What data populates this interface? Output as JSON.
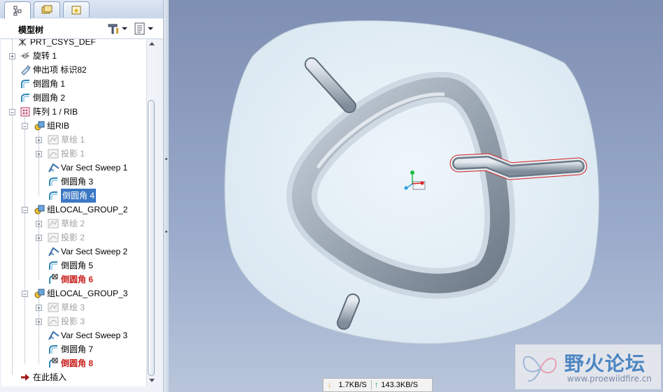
{
  "tree": {
    "title": "模型树",
    "items": [
      {
        "label": "PRT_CSYS_DEF",
        "style": ""
      },
      {
        "label": "旋转 1",
        "style": ""
      },
      {
        "label": "伸出项 标识82",
        "style": ""
      },
      {
        "label": "倒圆角 1",
        "style": ""
      },
      {
        "label": "倒圆角 2",
        "style": ""
      },
      {
        "label": "阵列 1 / RIB",
        "style": ""
      },
      {
        "label": "组RIB",
        "style": ""
      },
      {
        "label": "草绘 1",
        "style": "gray"
      },
      {
        "label": "投影 1",
        "style": "gray"
      },
      {
        "label": "Var Sect Sweep 1",
        "style": ""
      },
      {
        "label": "倒圆角 3",
        "style": ""
      },
      {
        "label": "倒圆角 4",
        "style": "sel"
      },
      {
        "label": "组LOCAL_GROUP_2",
        "style": ""
      },
      {
        "label": "草绘 2",
        "style": "gray"
      },
      {
        "label": "投影 2",
        "style": "gray"
      },
      {
        "label": "Var Sect Sweep 2",
        "style": ""
      },
      {
        "label": "倒圆角 5",
        "style": ""
      },
      {
        "label": "倒圆角 6",
        "style": "red"
      },
      {
        "label": "组LOCAL_GROUP_3",
        "style": ""
      },
      {
        "label": "草绘 3",
        "style": "gray"
      },
      {
        "label": "投影 3",
        "style": "gray"
      },
      {
        "label": "Var Sect Sweep 3",
        "style": ""
      },
      {
        "label": "倒圆角 7",
        "style": ""
      },
      {
        "label": "倒圆角 8",
        "style": "red"
      },
      {
        "label": "在此插入",
        "style": ""
      }
    ]
  },
  "status": {
    "download": "1.7KB/S",
    "upload": "143.3KB/S"
  },
  "watermark": {
    "name": "野火论坛",
    "url": "www.proewildfire.cn"
  },
  "colors": {
    "selection": "#3a77c4",
    "failed_feature": "#c8201e",
    "viewport_bg": "#8fa0c2",
    "model": "#e3eef6"
  }
}
